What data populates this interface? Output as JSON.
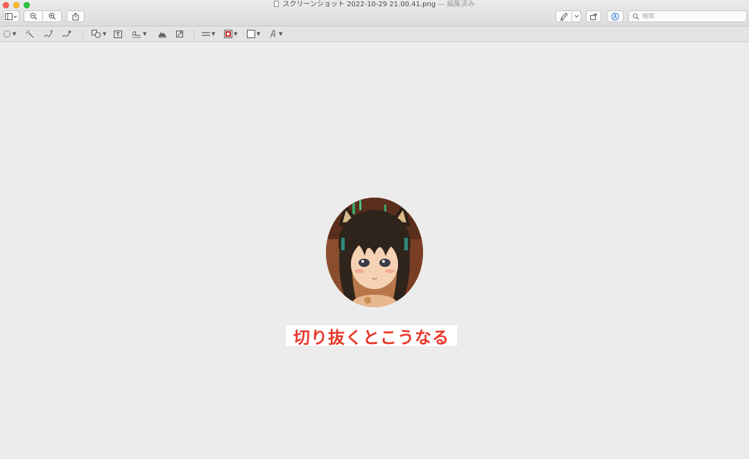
{
  "window": {
    "title": "スクリーンショット 2022-10-29 21.00.41.png",
    "edited_suffix": "— 編集済み"
  },
  "toolbar": {
    "search_placeholder": "検索",
    "icons": [
      "sidebar-icon",
      "zoom-out-icon",
      "zoom-in-icon",
      "share-icon",
      "pen-icon",
      "rotate-icon",
      "markup-icon",
      "search-icon"
    ]
  },
  "markup": {
    "tools": [
      "selection-icon",
      "instant-alpha-icon",
      "sketch-icon",
      "draw-icon",
      "shapes-icon",
      "text-icon",
      "sign-icon",
      "adjust-color-icon",
      "adjust-size-icon",
      "shape-style-icon",
      "border-color-icon",
      "fill-color-icon",
      "text-style-icon"
    ],
    "border_color": "#c0281e"
  },
  "canvas": {
    "caption": "切り抜くとこうなる",
    "caption_color": "#e8382a",
    "background": "#ececec"
  }
}
